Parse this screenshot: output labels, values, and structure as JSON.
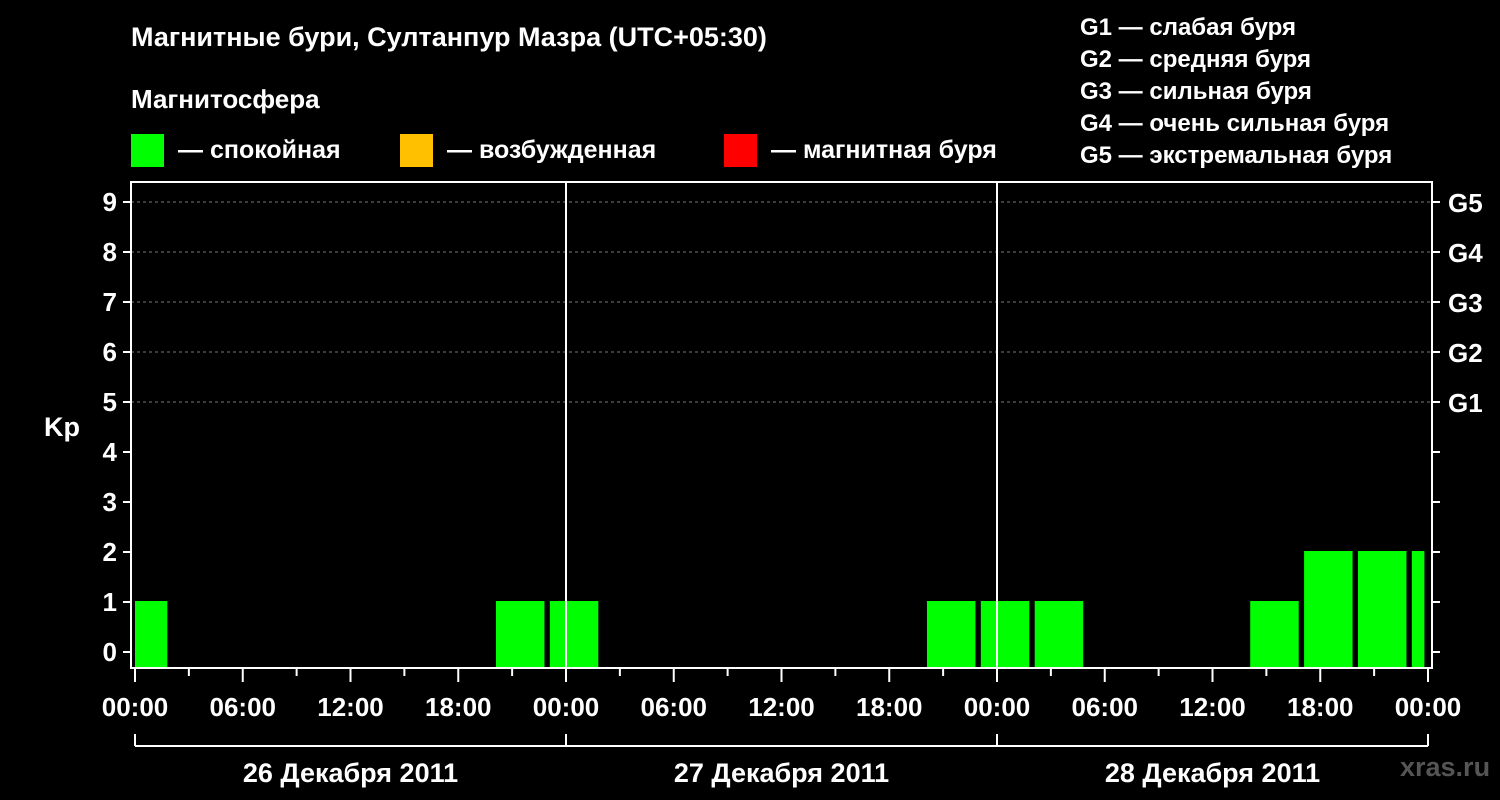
{
  "chart_data": {
    "type": "bar",
    "title": "Магнитные бури, Султанпур Мазра (UTC+05:30)",
    "subtitle": "Магнитосфера",
    "ylabel": "Kp",
    "ylim": [
      0,
      9
    ],
    "yticks": [
      "0",
      "1",
      "2",
      "3",
      "4",
      "5",
      "6",
      "7",
      "8",
      "9"
    ],
    "g_scale": [
      {
        "kp": 5,
        "label": "G1"
      },
      {
        "kp": 6,
        "label": "G2"
      },
      {
        "kp": 7,
        "label": "G3"
      },
      {
        "kp": 8,
        "label": "G4"
      },
      {
        "kp": 9,
        "label": "G5"
      }
    ],
    "x_range_hours": [
      0,
      72
    ],
    "x_tick_labels": [
      "00:00",
      "06:00",
      "12:00",
      "18:00",
      "00:00",
      "06:00",
      "12:00",
      "18:00",
      "00:00",
      "06:00",
      "12:00",
      "18:00",
      "00:00"
    ],
    "days": [
      "26 Декабря 2011",
      "27 Декабря 2011",
      "28 Декабря 2011"
    ],
    "legend": [
      {
        "label": "— спокойная",
        "color": "#00ff00"
      },
      {
        "label": "— возбужденная",
        "color": "#ffc000"
      },
      {
        "label": "— магнитная буря",
        "color": "#ff0000"
      }
    ],
    "g_legend": [
      "G1 — слабая буря",
      "G2 — средняя буря",
      "G3 — сильная буря",
      "G4 — очень сильная буря",
      "G5 — экстремальная буря"
    ],
    "bars": [
      {
        "start_hour": 0,
        "end_hour": 1.8,
        "kp": 1,
        "color": "#00ff00"
      },
      {
        "start_hour": 20.1,
        "end_hour": 22.8,
        "kp": 1,
        "color": "#00ff00"
      },
      {
        "start_hour": 23.1,
        "end_hour": 25.8,
        "kp": 1,
        "color": "#00ff00"
      },
      {
        "start_hour": 44.1,
        "end_hour": 46.8,
        "kp": 1,
        "color": "#00ff00"
      },
      {
        "start_hour": 47.1,
        "end_hour": 49.8,
        "kp": 1,
        "color": "#00ff00"
      },
      {
        "start_hour": 50.1,
        "end_hour": 52.8,
        "kp": 1,
        "color": "#00ff00"
      },
      {
        "start_hour": 62.1,
        "end_hour": 64.8,
        "kp": 1,
        "color": "#00ff00"
      },
      {
        "start_hour": 65.1,
        "end_hour": 67.8,
        "kp": 2,
        "color": "#00ff00"
      },
      {
        "start_hour": 68.1,
        "end_hour": 70.8,
        "kp": 2,
        "color": "#00ff00"
      },
      {
        "start_hour": 71.1,
        "end_hour": 71.8,
        "kp": 2,
        "color": "#00ff00"
      }
    ],
    "watermark": "xras.ru"
  }
}
